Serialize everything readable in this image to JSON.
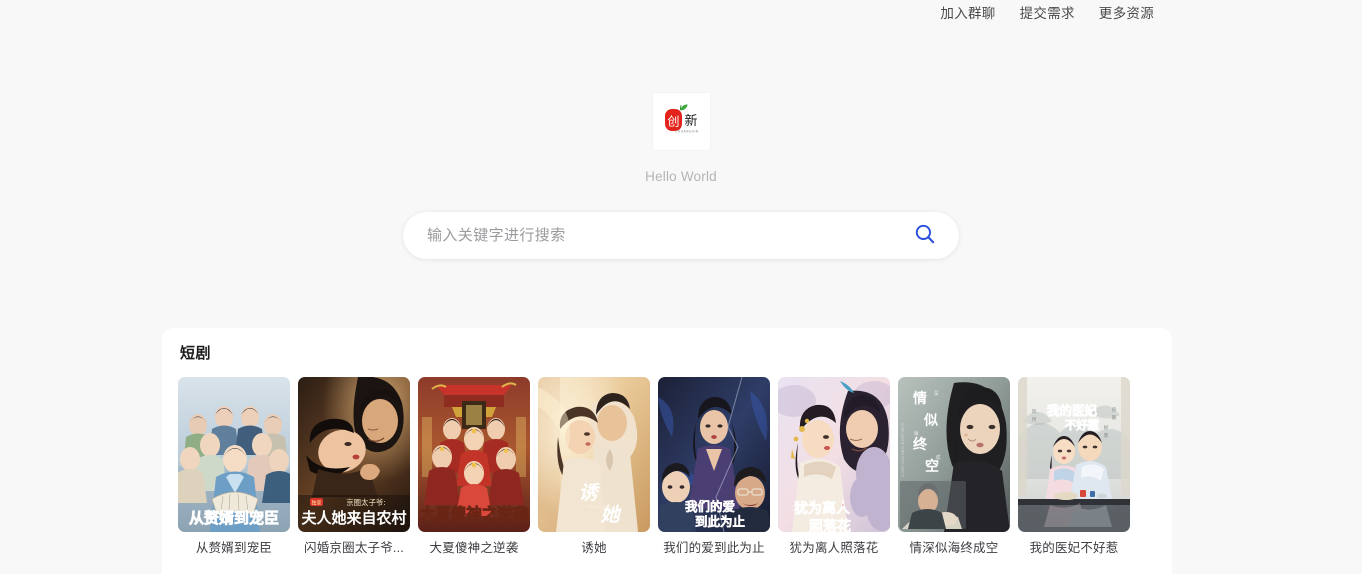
{
  "topnav": {
    "links": [
      {
        "label": "加入群聊",
        "name": "nav-join-group"
      },
      {
        "label": "提交需求",
        "name": "nav-submit-request"
      },
      {
        "label": "更多资源",
        "name": "nav-more-resources"
      }
    ]
  },
  "hero": {
    "logo_icon": "chuangxin-logo-icon",
    "logo_main_char": "创",
    "logo_secondary_char": "新",
    "logo_subtext": "CHUANGXIN",
    "tagline": "Hello World"
  },
  "search": {
    "placeholder": "输入关键字进行搜索",
    "value": "",
    "icon": "search-icon",
    "icon_color": "#2a4fdc"
  },
  "section": {
    "title": "短剧"
  },
  "colors": {
    "page_background": "#f8f8f9",
    "panel_background": "#ffffff",
    "accent": "#2a4fdc",
    "nav_text": "#4a4a4a",
    "tagline_text": "#b4b4b8",
    "caption_text": "#3d3d42"
  },
  "cards": [
    {
      "title": "从赘婿到宠臣",
      "poster": "ensemble-blue-costume-poster"
    },
    {
      "title": "闪婚京圈太子爷...",
      "poster": "dark-romance-closeup-poster"
    },
    {
      "title": "大夏傻神之逆袭",
      "poster": "red-gold-palace-poster"
    },
    {
      "title": "诱她",
      "poster": "warm-golden-couple-poster"
    },
    {
      "title": "我们的爱到此为止",
      "poster": "dark-blue-modern-drama-poster"
    },
    {
      "title": "犹为离人照落花",
      "poster": "pastel-pink-costume-poster"
    },
    {
      "title": "情深似海终成空",
      "poster": "gray-melancholy-poster"
    },
    {
      "title": "我的医妃不好惹",
      "poster": "light-inkwash-hanfu-poster"
    }
  ]
}
